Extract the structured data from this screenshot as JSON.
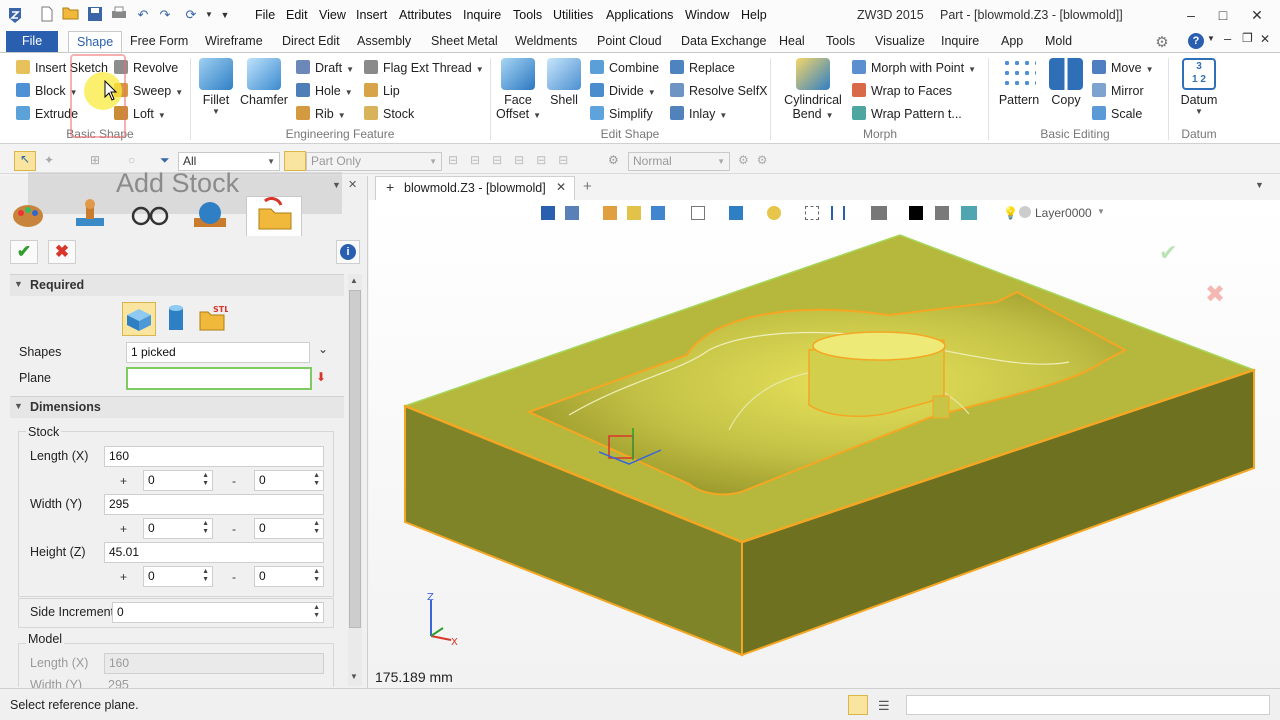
{
  "title_bar": {
    "menu": [
      "File",
      "Edit",
      "View",
      "Insert",
      "Attributes",
      "Inquire",
      "Tools",
      "Utilities",
      "Applications",
      "Window",
      "Help"
    ],
    "app_name": "ZW3D 2015",
    "window_title": "Part - [blowmold.Z3 - [blowmold]]"
  },
  "ribbon_tabs": [
    "File",
    "Shape",
    "Free Form",
    "Wireframe",
    "Direct Edit",
    "Assembly",
    "Sheet Metal",
    "Weldments",
    "Point Cloud",
    "Data Exchange",
    "Heal",
    "Tools",
    "Visualize",
    "Inquire",
    "App",
    "Mold"
  ],
  "active_tab": "Shape",
  "ribbon": {
    "basic_shape": {
      "label": "Basic Shape",
      "insert_sketch": "Insert Sketch",
      "revolve": "Revolve",
      "block": "Block",
      "sweep": "Sweep",
      "extrude": "Extrude",
      "loft": "Loft"
    },
    "engineering_feature": {
      "label": "Engineering Feature",
      "fillet": "Fillet",
      "chamfer": "Chamfer",
      "draft": "Draft",
      "hole": "Hole",
      "rib": "Rib",
      "flag_ext_thread": "Flag Ext Thread",
      "lip": "Lip",
      "stock": "Stock"
    },
    "edit_shape": {
      "label": "Edit Shape",
      "face_offset": "Face",
      "face_offset_2": "Offset",
      "shell": "Shell",
      "combine": "Combine",
      "divide": "Divide",
      "simplify": "Simplify",
      "replace": "Replace",
      "resolve_selfx": "Resolve SelfX",
      "inlay": "Inlay"
    },
    "morph": {
      "label": "Morph",
      "cylindrical_bend": "Cylindrical",
      "cylindrical_bend_2": "Bend",
      "morph_with_point": "Morph with Point",
      "wrap_to_faces": "Wrap to Faces",
      "wrap_pattern": "Wrap Pattern t..."
    },
    "basic_editing": {
      "label": "Basic Editing",
      "pattern": "Pattern",
      "copy": "Copy",
      "move": "Move",
      "mirror": "Mirror",
      "scale": "Scale"
    },
    "datum": {
      "label": "Datum",
      "datum": "Datum"
    }
  },
  "toolbar": {
    "filter_value": "All",
    "part_only": "Part Only",
    "render_mode": "Normal"
  },
  "panel": {
    "overlay_title": "Add Stock",
    "required_header": "Required",
    "shapes_label": "Shapes",
    "shapes_value": "1 picked",
    "plane_label": "Plane",
    "plane_value": "",
    "dimensions_header": "Dimensions",
    "stock_group": "Stock",
    "length_label": "Length (X)",
    "length_value": "160",
    "width_label": "Width (Y)",
    "width_value": "295",
    "height_label": "Height (Z)",
    "height_value": "45.01",
    "offset_values": [
      "0",
      "0",
      "0",
      "0",
      "0",
      "0"
    ],
    "plus": "+",
    "minus": "-",
    "side_increment_label": "Side Increment",
    "side_increment_value": "0",
    "model_group": "Model",
    "model_length_label": "Length (X)",
    "model_length_value": "160",
    "model_width_label": "Width (Y)",
    "model_width_value": "295"
  },
  "viewport": {
    "doc_tab": "blowmold.Z3 - [blowmold]",
    "layer": "Layer0000",
    "measurement": "175.189 mm"
  },
  "status": {
    "message": "Select reference plane."
  },
  "colors": {
    "file_tab": "#2a5fb0",
    "model_top": "#b8bb3c",
    "model_edge": "#f5a623",
    "accept": "#2e9e2e",
    "cancel": "#d9362b"
  }
}
